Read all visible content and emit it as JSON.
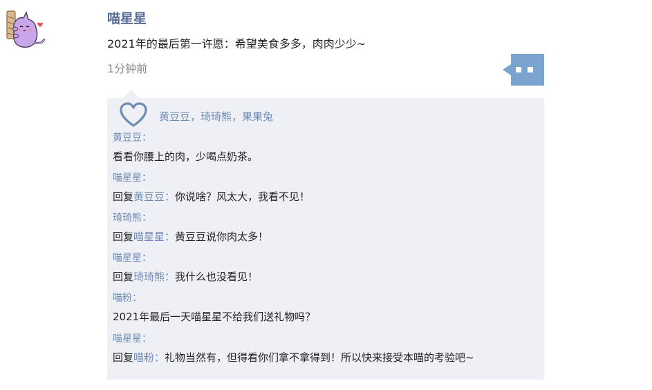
{
  "post": {
    "author": "喵星星",
    "text": "2021年的最后第一许愿：希望美食多多，肉肉少少~",
    "time": "1分钟前"
  },
  "likes": {
    "names": "黄豆豆，琦琦熊，果果兔"
  },
  "comments": [
    {
      "author": "黄豆豆：",
      "text": "看看你腰上的肉，少喝点奶茶。"
    },
    {
      "author": "喵星星：",
      "reply_label": "回复",
      "reply_to": "黄豆豆",
      "sep": "：",
      "text": "你说啥？风太大，我看不见！"
    },
    {
      "author": "琦琦熊：",
      "reply_label": "回复",
      "reply_to": "喵星星",
      "sep": "：",
      "text": "黄豆豆说你肉太多！"
    },
    {
      "author": "喵星星：",
      "reply_label": "回复",
      "reply_to": "琦琦熊",
      "sep": "：",
      "text": "我什么也没看见！"
    },
    {
      "author": "喵粉：",
      "text": "2021年最后一天喵星星不给我们送礼物吗？"
    },
    {
      "author": "喵星星：",
      "reply_label": "回复",
      "reply_to": "喵粉",
      "sep": "：",
      "text": "礼物当然有，但得看你们拿不拿得到！所以快来接受本喵的考验吧~"
    }
  ],
  "colors": {
    "name_blue": "#576b95",
    "link_blue": "#6c8bb5",
    "panel_bg": "#eff0f6",
    "more_button_bg": "#7aa3d0",
    "avatar_cat": "#c9a6ea"
  },
  "icons": {
    "avatar": "purple-cat-avatar",
    "more": "more-dots-icon",
    "like": "heart-outline-icon"
  }
}
